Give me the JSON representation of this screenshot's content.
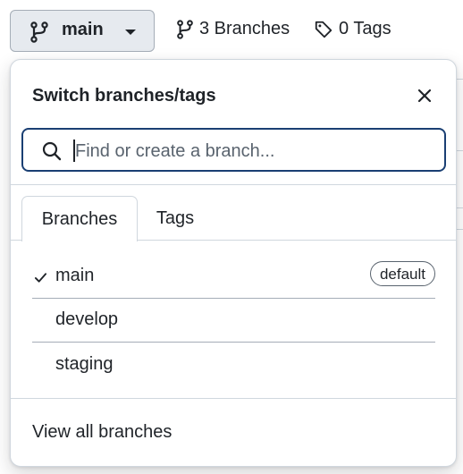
{
  "header": {
    "current_branch": "main",
    "branches_link": "3 Branches",
    "tags_link": "0 Tags"
  },
  "popover": {
    "title": "Switch branches/tags",
    "search": {
      "placeholder": "Find or create a branch...",
      "value": ""
    },
    "tabs": [
      {
        "label": "Branches",
        "active": true
      },
      {
        "label": "Tags",
        "active": false
      }
    ],
    "branches": [
      {
        "name": "main",
        "selected": true,
        "badge": "default"
      },
      {
        "name": "develop",
        "selected": false,
        "badge": ""
      },
      {
        "name": "staging",
        "selected": false,
        "badge": ""
      }
    ],
    "footer_link": "View all branches"
  },
  "colors": {
    "button_bg": "#e6eaef",
    "focus_border": "#1a3f73",
    "text": "#1f2328",
    "muted_text": "#59636e",
    "border": "#d0d7de"
  },
  "icons": [
    "git-branch-icon",
    "chevron-down-icon",
    "tag-icon",
    "close-icon",
    "search-icon",
    "check-icon"
  ]
}
